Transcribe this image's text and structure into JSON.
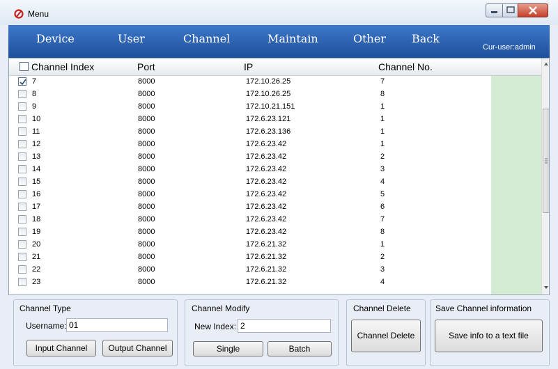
{
  "window": {
    "title": "Menu"
  },
  "menubar": {
    "items": [
      {
        "label": "Device"
      },
      {
        "label": "User"
      },
      {
        "label": "Channel"
      },
      {
        "label": "Maintain"
      },
      {
        "label": "Other"
      },
      {
        "label": "Back"
      }
    ],
    "cur_user": "Cur-user:admin"
  },
  "table": {
    "headers": {
      "index": "Channel Index",
      "port": "Port",
      "ip": "IP",
      "channel_no": "Channel No."
    },
    "rows": [
      {
        "checked": true,
        "index": "7",
        "port": "8000",
        "ip": "172.10.26.25",
        "channel_no": "7"
      },
      {
        "checked": false,
        "index": "8",
        "port": "8000",
        "ip": "172.10.26.25",
        "channel_no": "8"
      },
      {
        "checked": false,
        "index": "9",
        "port": "8000",
        "ip": "172.10.21.151",
        "channel_no": "1"
      },
      {
        "checked": false,
        "index": "10",
        "port": "8000",
        "ip": "172.6.23.121",
        "channel_no": "1"
      },
      {
        "checked": false,
        "index": "11",
        "port": "8000",
        "ip": "172.6.23.136",
        "channel_no": "1"
      },
      {
        "checked": false,
        "index": "12",
        "port": "8000",
        "ip": "172.6.23.42",
        "channel_no": "1"
      },
      {
        "checked": false,
        "index": "13",
        "port": "8000",
        "ip": "172.6.23.42",
        "channel_no": "2"
      },
      {
        "checked": false,
        "index": "14",
        "port": "8000",
        "ip": "172.6.23.42",
        "channel_no": "3"
      },
      {
        "checked": false,
        "index": "15",
        "port": "8000",
        "ip": "172.6.23.42",
        "channel_no": "4"
      },
      {
        "checked": false,
        "index": "16",
        "port": "8000",
        "ip": "172.6.23.42",
        "channel_no": "5"
      },
      {
        "checked": false,
        "index": "17",
        "port": "8000",
        "ip": "172.6.23.42",
        "channel_no": "6"
      },
      {
        "checked": false,
        "index": "18",
        "port": "8000",
        "ip": "172.6.23.42",
        "channel_no": "7"
      },
      {
        "checked": false,
        "index": "19",
        "port": "8000",
        "ip": "172.6.23.42",
        "channel_no": "8"
      },
      {
        "checked": false,
        "index": "20",
        "port": "8000",
        "ip": "172.6.21.32",
        "channel_no": "1"
      },
      {
        "checked": false,
        "index": "21",
        "port": "8000",
        "ip": "172.6.21.32",
        "channel_no": "2"
      },
      {
        "checked": false,
        "index": "22",
        "port": "8000",
        "ip": "172.6.21.32",
        "channel_no": "3"
      },
      {
        "checked": false,
        "index": "23",
        "port": "8000",
        "ip": "172.6.21.32",
        "channel_no": "4"
      }
    ],
    "highlight_color": "#d4ecd4"
  },
  "channel_type": {
    "title": "Channel Type",
    "username_label": "Username:",
    "username_value": "01",
    "input_button": "Input Channel",
    "output_button": "Output Channel"
  },
  "channel_modify": {
    "title": "Channel Modify",
    "new_index_label": "New Index:",
    "new_index_value": "2",
    "single_button": "Single",
    "batch_button": "Batch"
  },
  "channel_delete": {
    "title": "Channel Delete",
    "delete_button": "Channel Delete"
  },
  "save_info": {
    "title": "Save Channel information",
    "save_button": "Save info to a text file"
  },
  "colors": {
    "menubar": "#2a5fad",
    "close_button": "#c5412c"
  },
  "icons": [
    "app-icon",
    "minimize-icon",
    "maximize-icon",
    "close-icon",
    "checkmark-icon",
    "scroll-up-icon",
    "scroll-down-icon",
    "grip-icon"
  ]
}
